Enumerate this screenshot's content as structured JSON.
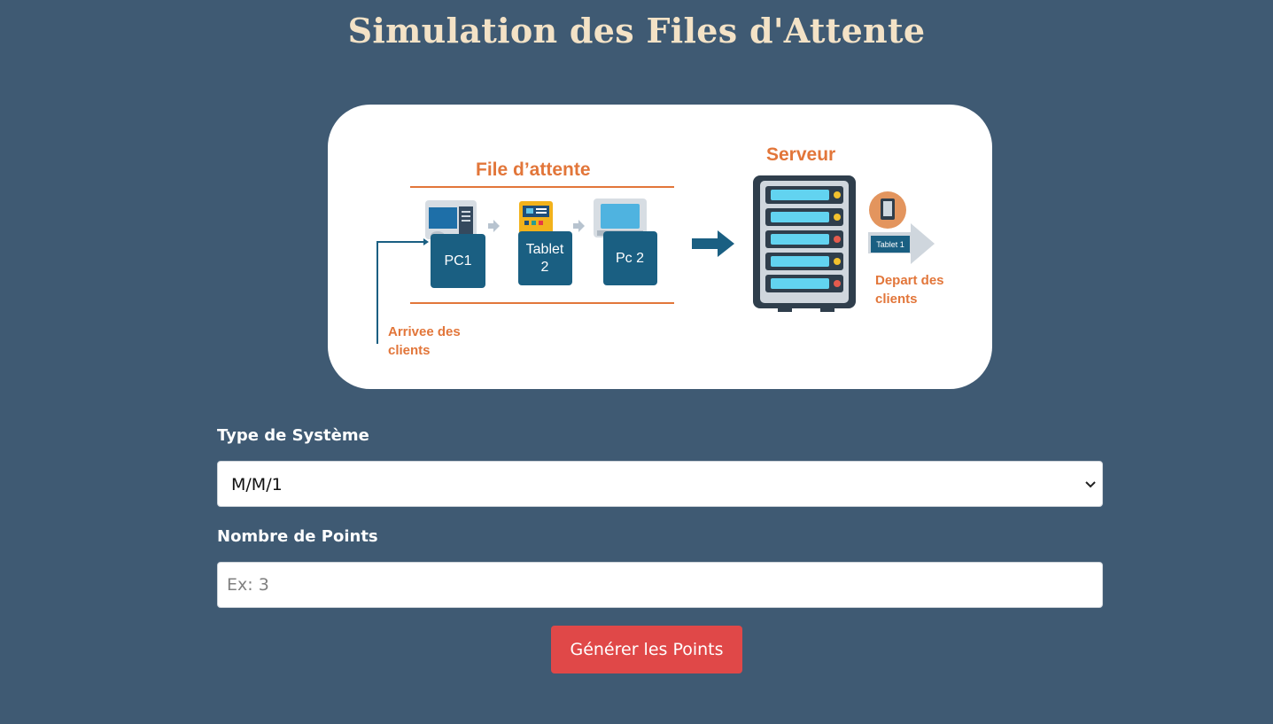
{
  "page": {
    "title": "Simulation des Files d'Attente"
  },
  "diagram": {
    "queue_title": "File d’attente",
    "server_title": "Serveur",
    "queue_items": [
      "PC1",
      "Tablet",
      "2",
      "Pc 2"
    ],
    "departing_item": "Tablet 1",
    "arrival_label": [
      "Arrivee des",
      "clients"
    ],
    "departure_label": [
      "Depart des",
      "clients"
    ],
    "colors": {
      "accent_orange": "#e2763a",
      "box_blue": "#1a5f82"
    }
  },
  "form": {
    "system_type_label": "Type de Système",
    "system_type_value": "M/M/1",
    "points_label": "Nombre de Points",
    "points_placeholder": "Ex: 3",
    "points_value": "",
    "submit_label": "Générer les Points"
  },
  "colors": {
    "background": "#3f5a73",
    "title": "#f3e2c6",
    "button": "#e04848"
  }
}
